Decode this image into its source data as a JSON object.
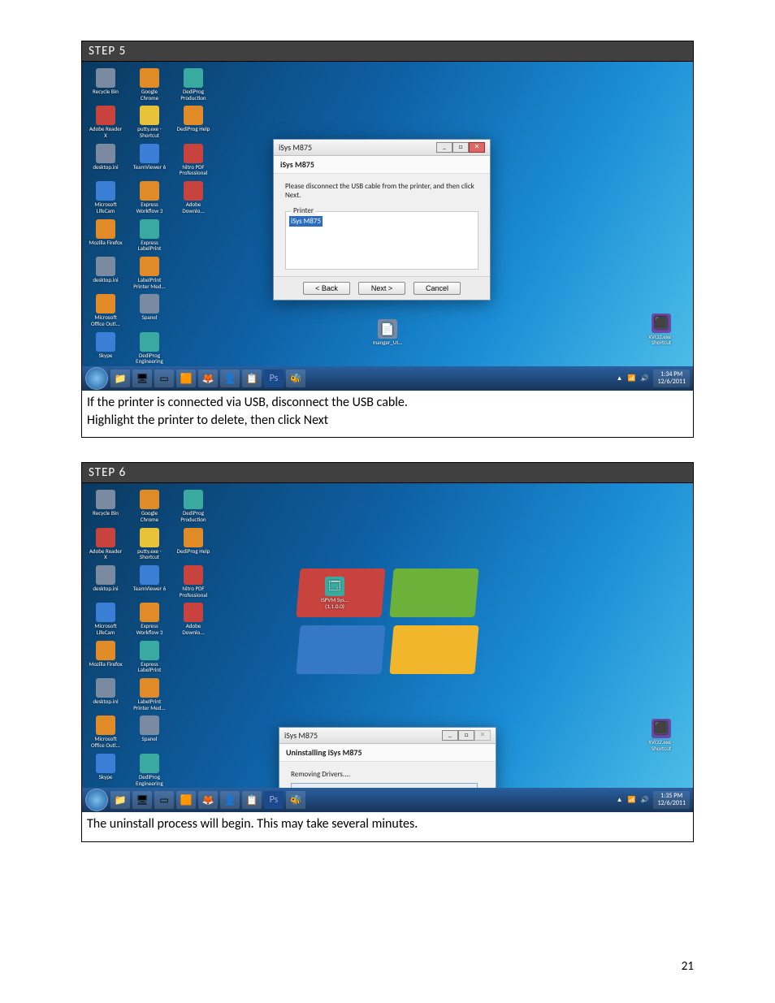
{
  "page_number": "21",
  "steps": [
    {
      "header": "STEP 5",
      "caption_line1": "If the printer is connected via USB, disconnect the USB cable.",
      "caption_line2": "Highlight the printer to delete, then click Next",
      "dialog": {
        "title": "iSys M875",
        "subtitle": "iSys M875",
        "message": "Please disconnect the USB cable from the printer, and then click Next.",
        "group_label": "Printer",
        "selected_printer": "iSys M875",
        "btn_back": "< Back",
        "btn_next": "Next >",
        "btn_cancel": "Cancel"
      },
      "center_icon_label": "manger_UI...",
      "right_icon_label": "XVI32.exe - Shortcut",
      "clock": {
        "time": "1:34 PM",
        "date": "12/6/2011"
      }
    },
    {
      "header": "STEP 6",
      "caption_line1": "The uninstall process will begin.  This may take several minutes.",
      "caption_line2": "",
      "dialog": {
        "title": "iSys M875",
        "subtitle": "Uninstalling iSys M875",
        "status": "Removing Drivers...."
      },
      "upper_icon_label": "ISPVM Sys... (1.1.0.0)",
      "right_icon_label": "XVI32.exe - Shortcut",
      "clock": {
        "time": "1:35 PM",
        "date": "12/6/2011"
      }
    }
  ],
  "desktop_icons": [
    [
      "Recycle Bin",
      "Google Chrome",
      "DediProg Production"
    ],
    [
      "Adobe Reader X",
      "putty.exe - Shortcut",
      "DediProg Help"
    ],
    [
      "desktop.ini",
      "TeamViewer 6",
      "Nitro PDF Professional"
    ],
    [
      "Microsoft LifeCam",
      "Express Workflow 3",
      "Adobe Downlo..."
    ],
    [
      "Mozilla Firefox",
      "Express LabelPrint",
      ""
    ],
    [
      "desktop.ini",
      "LabelPrint Printer Med...",
      ""
    ],
    [
      "Microsoft Office Outl...",
      "Spanel",
      ""
    ],
    [
      "Skype",
      "DediProg Engineering",
      ""
    ]
  ],
  "icon_colors": [
    [
      "c-gray",
      "c-orange",
      "c-teal"
    ],
    [
      "c-red",
      "c-yellow",
      "c-orange"
    ],
    [
      "c-gray",
      "c-blue",
      "c-red"
    ],
    [
      "c-blue",
      "c-orange",
      "c-red"
    ],
    [
      "c-orange",
      "c-teal",
      ""
    ],
    [
      "c-gray",
      "c-orange",
      ""
    ],
    [
      "c-orange",
      "c-gray",
      ""
    ],
    [
      "c-blue",
      "c-teal",
      ""
    ]
  ]
}
